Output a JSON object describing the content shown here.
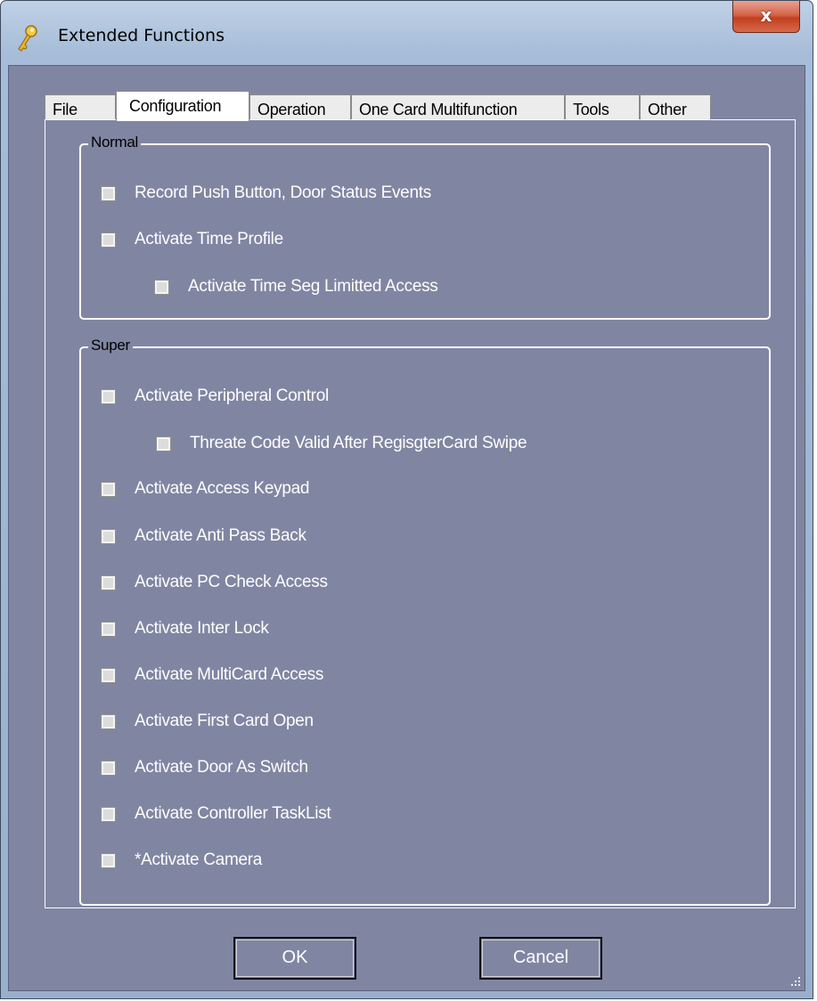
{
  "window": {
    "title": "Extended Functions",
    "close_label": "x"
  },
  "icons": {
    "app": "key-icon",
    "close": "close-icon",
    "grip": "resize-grip-icon"
  },
  "tabs": [
    {
      "label": "File",
      "active": false
    },
    {
      "label": "Configuration",
      "active": true
    },
    {
      "label": "Operation",
      "active": false
    },
    {
      "label": "One Card Multifunction",
      "active": false
    },
    {
      "label": "Tools",
      "active": false
    },
    {
      "label": "Other",
      "active": false
    }
  ],
  "normal": {
    "title": "Normal",
    "options": [
      {
        "label": "Record Push Button, Door Status Events",
        "checked": false
      },
      {
        "label": "Activate Time Profile",
        "checked": false
      },
      {
        "label": "Activate Time Seg Limitted Access",
        "checked": false
      }
    ]
  },
  "super": {
    "title": "Super",
    "options": [
      {
        "label": "Activate Peripheral Control",
        "checked": false
      },
      {
        "label": "Threate Code Valid After RegisgterCard Swipe",
        "checked": false
      },
      {
        "label": "Activate Access Keypad",
        "checked": false
      },
      {
        "label": "Activate Anti Pass Back",
        "checked": false
      },
      {
        "label": "Activate PC Check Access",
        "checked": false
      },
      {
        "label": "Activate Inter Lock",
        "checked": false
      },
      {
        "label": "Activate MultiCard Access",
        "checked": false
      },
      {
        "label": "Activate First Card Open",
        "checked": false
      },
      {
        "label": "Activate Door As Switch",
        "checked": false
      },
      {
        "label": "Activate Controller TaskList",
        "checked": false
      },
      {
        "label": "*Activate Camera",
        "checked": false
      }
    ]
  },
  "buttons": {
    "ok": "OK",
    "cancel": "Cancel"
  },
  "colors": {
    "client_bg": "#8086a2",
    "label_text": "#ffffff",
    "close_red": "#c2401f"
  }
}
